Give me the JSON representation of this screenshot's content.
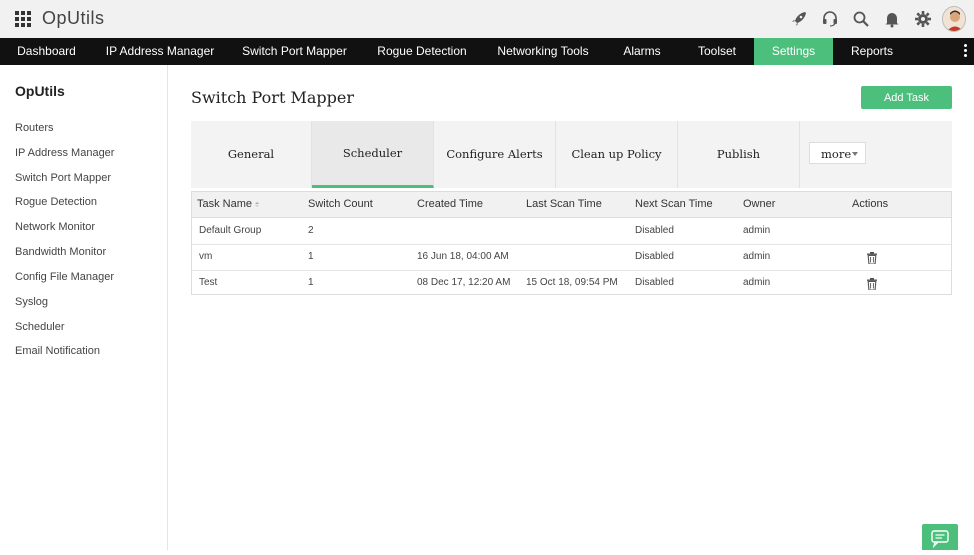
{
  "app": {
    "title": "OpUtils"
  },
  "colors": {
    "accent": "#4dbf7d",
    "navbar": "#111111",
    "topbar": "#f1f1f1"
  },
  "topbar_icons": [
    "rocket-icon",
    "headset-icon",
    "search-icon",
    "bell-icon",
    "gear-icon",
    "user-avatar"
  ],
  "nav": {
    "items": [
      {
        "label": "Dashboard"
      },
      {
        "label": "IP Address Manager"
      },
      {
        "label": "Switch Port Mapper"
      },
      {
        "label": "Rogue Detection"
      },
      {
        "label": "Networking Tools"
      },
      {
        "label": "Alarms"
      },
      {
        "label": "Toolset"
      },
      {
        "label": "Settings",
        "active": true
      },
      {
        "label": "Reports"
      }
    ]
  },
  "sidebar": {
    "title": "OpUtils",
    "items": [
      {
        "label": "Routers"
      },
      {
        "label": "IP Address Manager"
      },
      {
        "label": "Switch Port Mapper"
      },
      {
        "label": "Rogue Detection"
      },
      {
        "label": "Network Monitor"
      },
      {
        "label": "Bandwidth Monitor"
      },
      {
        "label": "Config File Manager"
      },
      {
        "label": "Syslog"
      },
      {
        "label": "Scheduler"
      },
      {
        "label": "Email Notification"
      }
    ]
  },
  "main": {
    "title": "Switch Port Mapper",
    "add_task_label": "Add Task",
    "tabs": [
      {
        "label": "General"
      },
      {
        "label": "Scheduler",
        "active": true
      },
      {
        "label": "Configure Alerts"
      },
      {
        "label": "Clean up Policy"
      },
      {
        "label": "Publish"
      }
    ],
    "more_label": "more"
  },
  "table": {
    "columns": [
      "Task Name",
      "Switch Count",
      "Created Time",
      "Last Scan Time",
      "Next Scan Time",
      "Owner",
      "Actions"
    ],
    "sorted_column": "Task Name",
    "rows": [
      {
        "task_name": "Default Group",
        "switch_count": "2",
        "created_time": "",
        "last_scan_time": "",
        "next_scan_time": "Disabled",
        "owner": "admin",
        "has_delete": false
      },
      {
        "task_name": "vm",
        "switch_count": "1",
        "created_time": "16 Jun 18, 04:00 AM",
        "last_scan_time": "",
        "next_scan_time": "Disabled",
        "owner": "admin",
        "has_delete": true
      },
      {
        "task_name": "Test",
        "switch_count": "1",
        "created_time": "08 Dec 17, 12:20 AM",
        "last_scan_time": "15 Oct 18, 09:54 PM",
        "next_scan_time": "Disabled",
        "owner": "admin",
        "has_delete": true
      }
    ]
  }
}
